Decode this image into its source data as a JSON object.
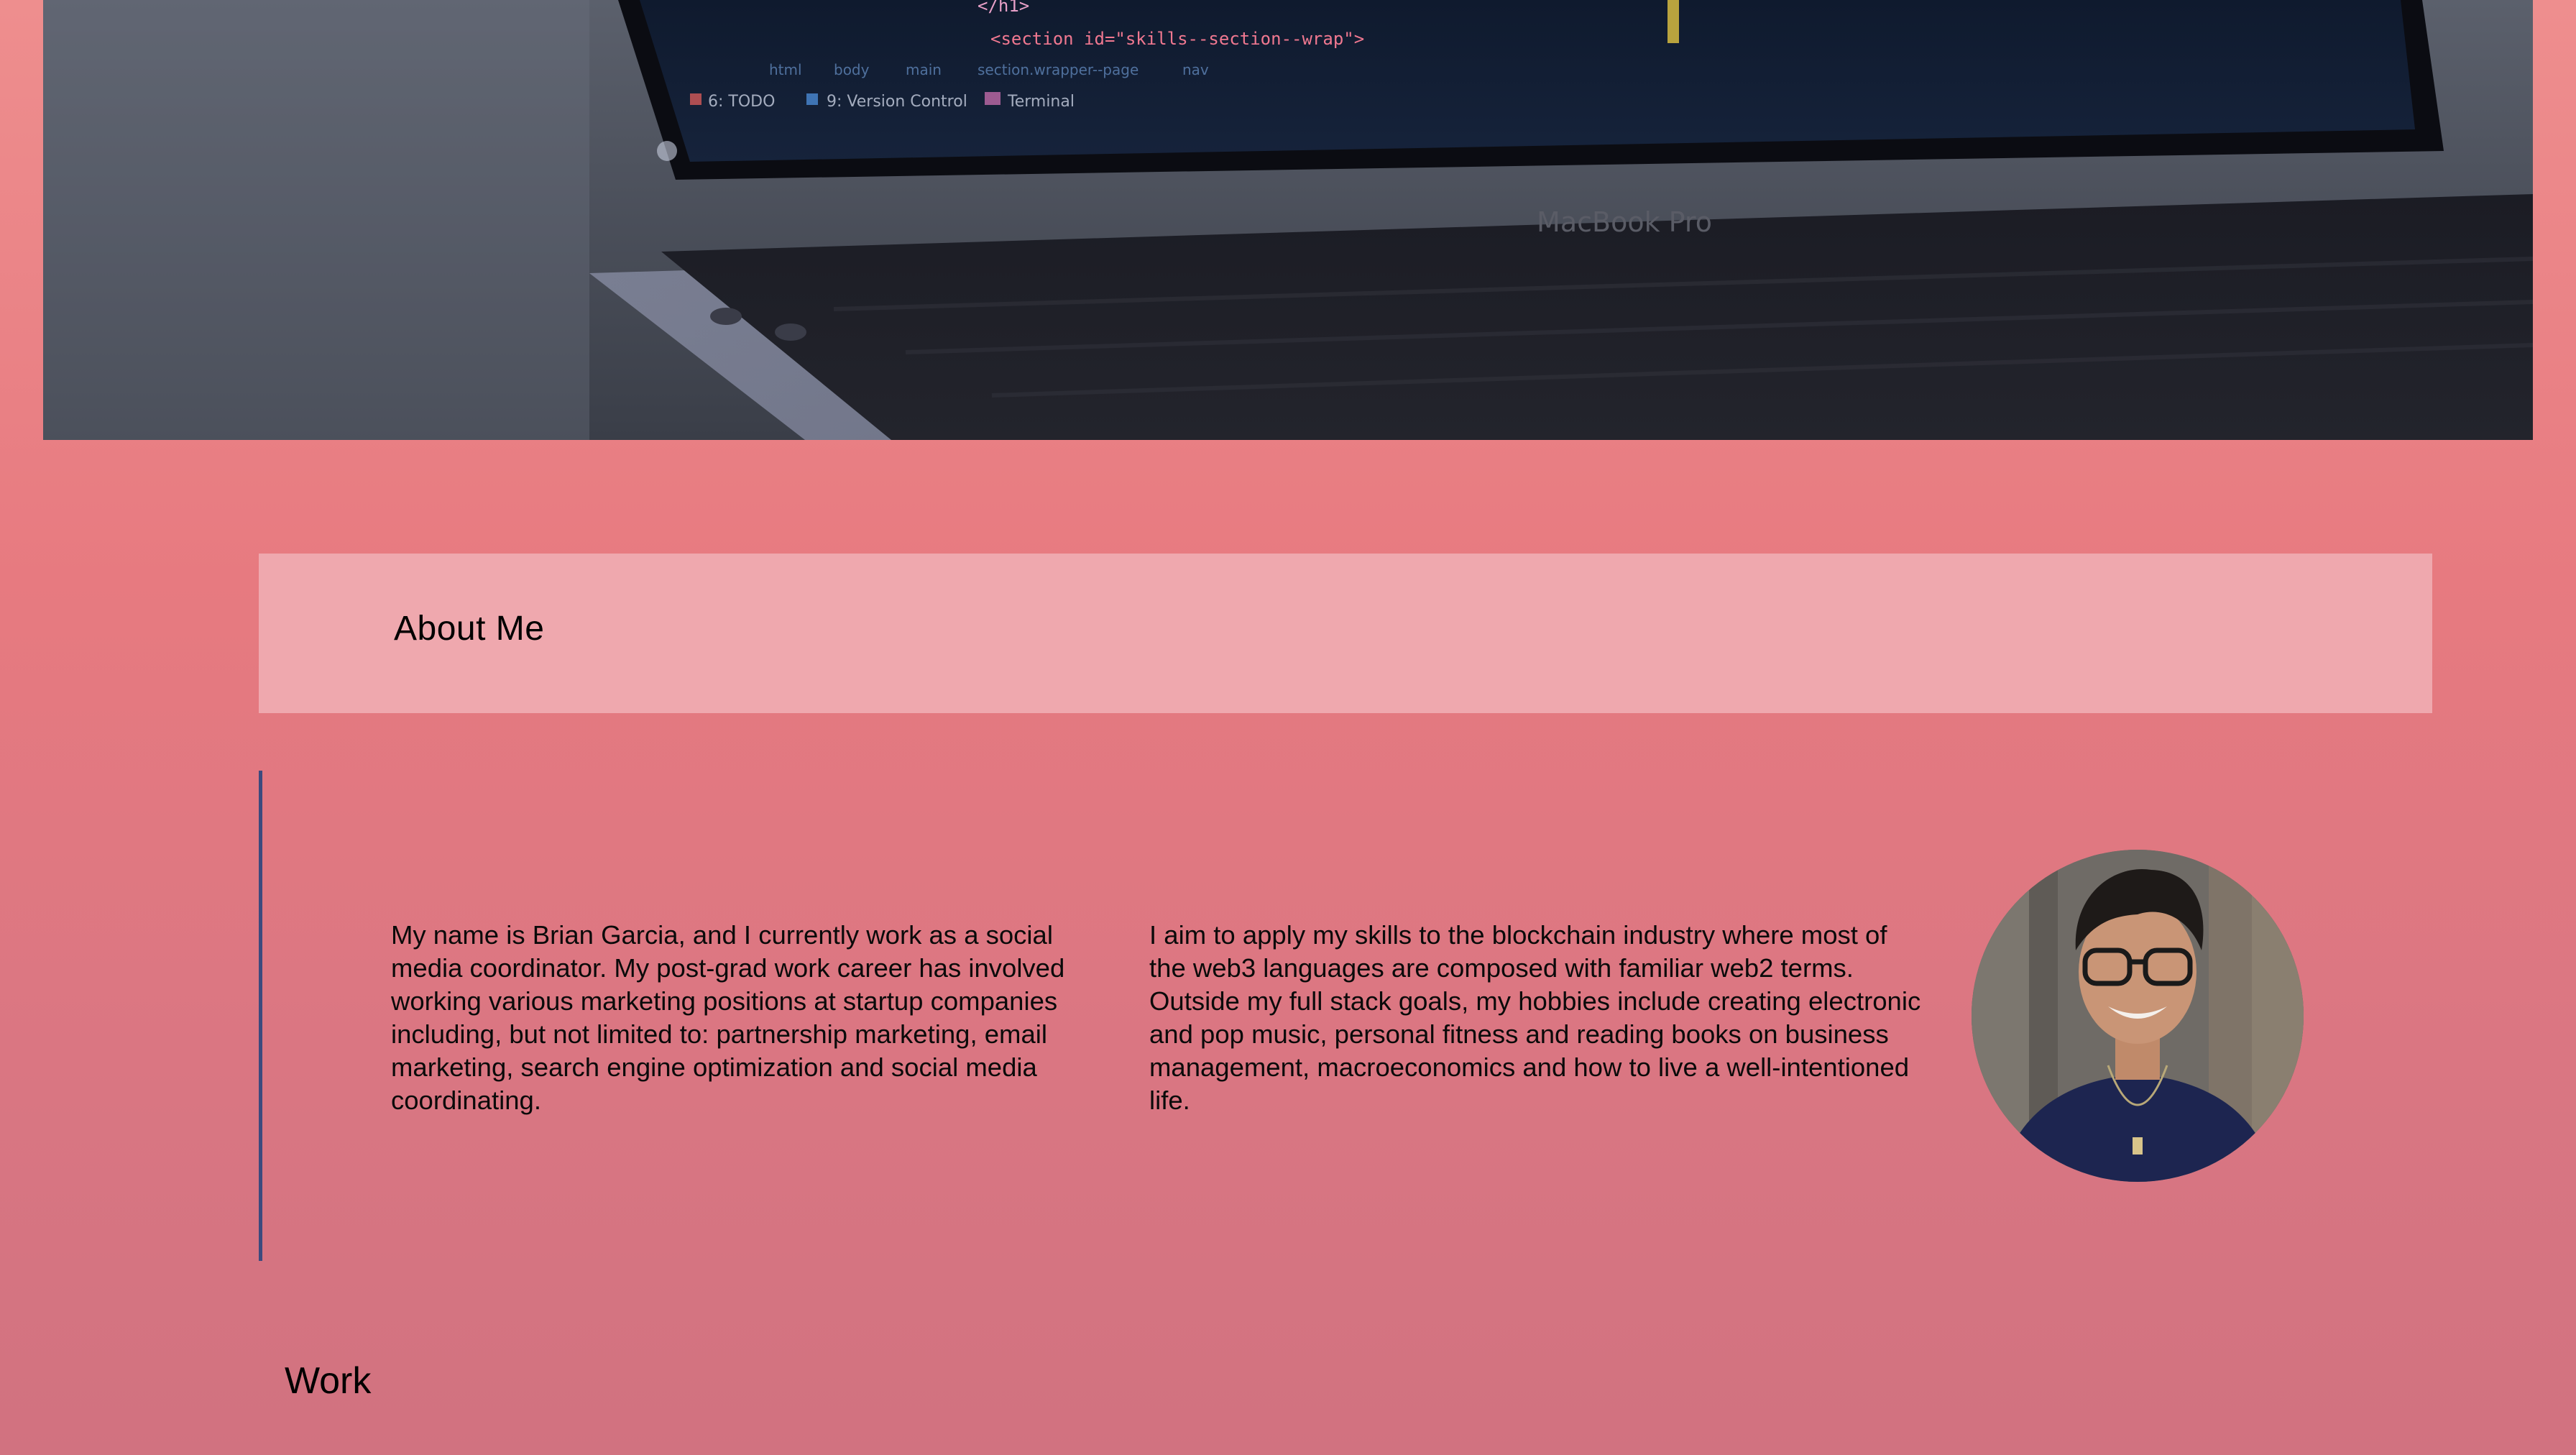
{
  "hero": {
    "code_lines": [
      "</h1>",
      "<section id=\"skills--section--wrap\">"
    ],
    "breadcrumb": [
      "html",
      "body",
      "main",
      "section.wrapper--page",
      "nav"
    ],
    "status_tabs": [
      "6: TODO",
      "9: Version Control",
      "Terminal"
    ],
    "laptop_brand": "MacBook Pro"
  },
  "about": {
    "heading": "About Me",
    "paragraph_1": "My name is Brian Garcia, and I currently work as a social media coordinator. My post-grad work career has involved working various marketing positions at startup companies including, but not limited to: partnership marketing, email marketing, search engine optimization and social media coordinating.",
    "paragraph_2": "I aim to apply my skills to the blockchain industry where most of the web3 languages are composed with familiar web2 terms. Outside my full stack goals, my hobbies include creating electronic and pop music, personal fitness and reading books on business management, macroeconomics and how to live a well-intentioned life."
  },
  "work": {
    "heading": "Work"
  },
  "colors": {
    "page_top": "#ee8e8e",
    "page_bottom": "#d17280",
    "about_band": "#efa8ae",
    "accent_bar": "#3c4a7e",
    "code_screen": "#14213a"
  }
}
